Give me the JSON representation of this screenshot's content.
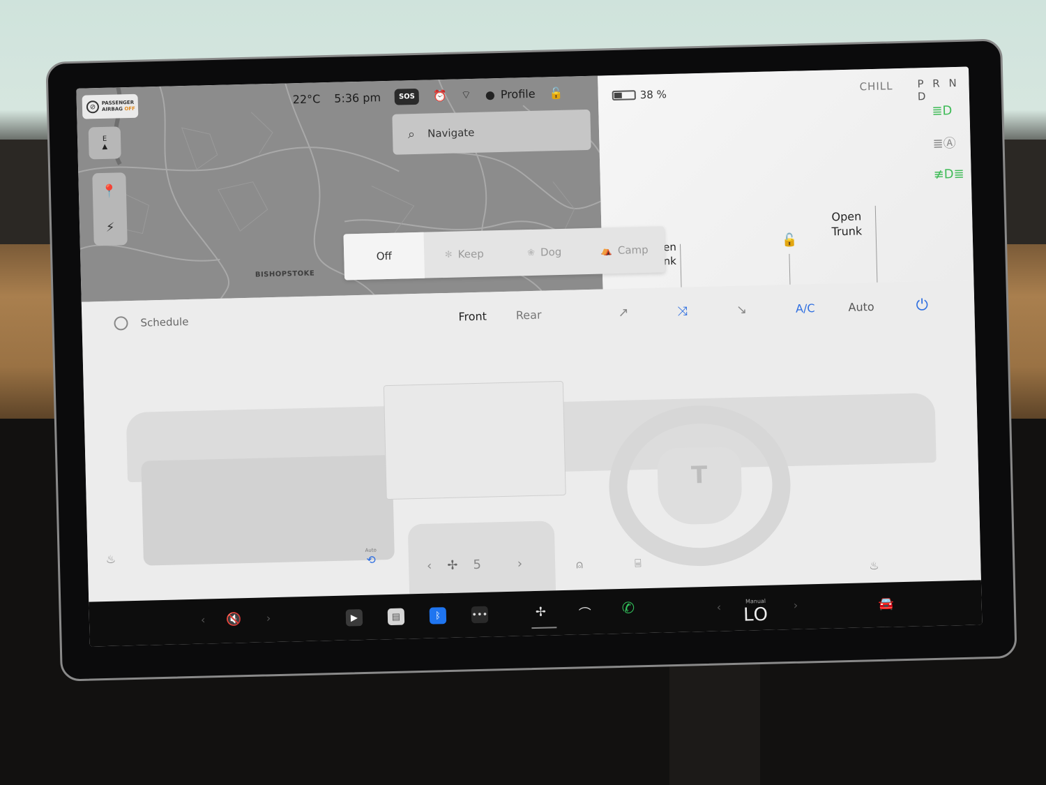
{
  "status": {
    "temperature": "22°C",
    "time": "5:36 pm",
    "sos_label": "SOS",
    "profile_label": "Profile"
  },
  "airbag": {
    "line1": "PASSENGER",
    "line2": "AIRBAG",
    "state": "OFF"
  },
  "compass": {
    "direction": "E"
  },
  "navigate": {
    "placeholder": "Navigate"
  },
  "map": {
    "place_label": "BISHOPSTOKE"
  },
  "car": {
    "battery_percent": "38 %",
    "battery_level": 0.38,
    "drive_mode": "CHILL",
    "gear_selector": "P R N D",
    "trunk_label_1": "Open",
    "trunk_label_2": "Trunk",
    "frunk_label_1": "en",
    "frunk_label_2": "nk"
  },
  "climate_modes": [
    {
      "label": "Off",
      "selected": true
    },
    {
      "label": "Keep",
      "selected": false
    },
    {
      "label": "Dog",
      "selected": false
    },
    {
      "label": "Camp",
      "selected": false
    }
  ],
  "climate": {
    "schedule_label": "Schedule",
    "front_label": "Front",
    "rear_label": "Rear",
    "ac_label": "A/C",
    "auto_label": "Auto",
    "auto_recirc_label": "Auto",
    "fan_speed": "5"
  },
  "bottom_bar": {
    "temp_mode_label": "Manual",
    "temp_value": "LO"
  },
  "colors": {
    "accent_blue": "#2f6fe0",
    "light_green": "#3fbb57",
    "phone_green": "#32c15b"
  }
}
